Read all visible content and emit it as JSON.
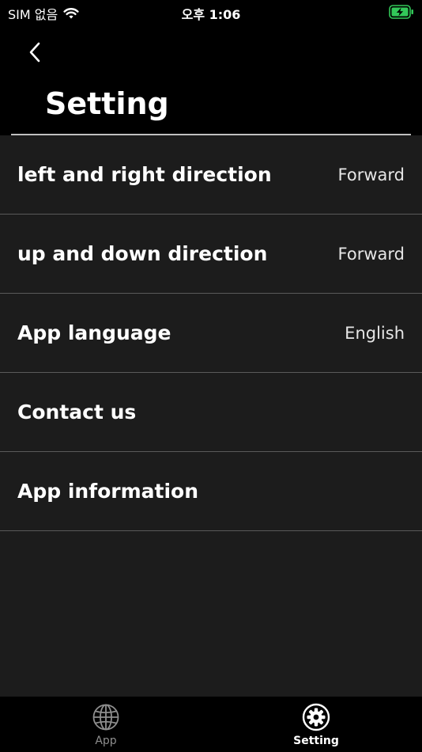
{
  "status_bar": {
    "carrier": "SIM 없음",
    "time": "오후 1:06",
    "battery_color": "#32c759"
  },
  "header": {
    "title": "Setting"
  },
  "settings": [
    {
      "label": "left and right direction",
      "value": "Forward"
    },
    {
      "label": "up and down direction",
      "value": "Forward"
    },
    {
      "label": "App language",
      "value": "English"
    },
    {
      "label": "Contact us",
      "value": ""
    },
    {
      "label": "App information",
      "value": ""
    }
  ],
  "tab_bar": {
    "tabs": [
      {
        "label": "App",
        "icon": "globe-icon",
        "active": false
      },
      {
        "label": "Setting",
        "icon": "gear-icon",
        "active": true
      }
    ]
  }
}
